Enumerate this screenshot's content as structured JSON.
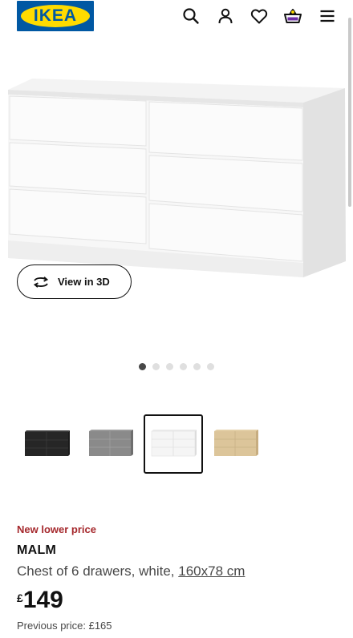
{
  "header": {
    "logo_text": "IKEA",
    "icons": [
      "search-icon",
      "profile-icon",
      "heart-icon",
      "basket-icon",
      "menu-icon"
    ]
  },
  "gallery": {
    "view_3d_label": "View in 3D",
    "dot_count": 6,
    "active_dot": 1
  },
  "variants": [
    {
      "color": "black-brown",
      "selected": false
    },
    {
      "color": "grey",
      "selected": false
    },
    {
      "color": "white",
      "selected": true
    },
    {
      "color": "white stained oak veneer",
      "selected": false
    }
  ],
  "product": {
    "badge": "New lower price",
    "name": "MALM",
    "description": "Chest of 6 drawers, white, ",
    "size_link": "160x78 cm",
    "currency": "£",
    "price": "149",
    "previous_price": "Previous price: £165"
  },
  "colors": {
    "ikea_blue": "#0058a3",
    "ikea_yellow": "#ffdb00",
    "badge_red": "#a5282c"
  }
}
